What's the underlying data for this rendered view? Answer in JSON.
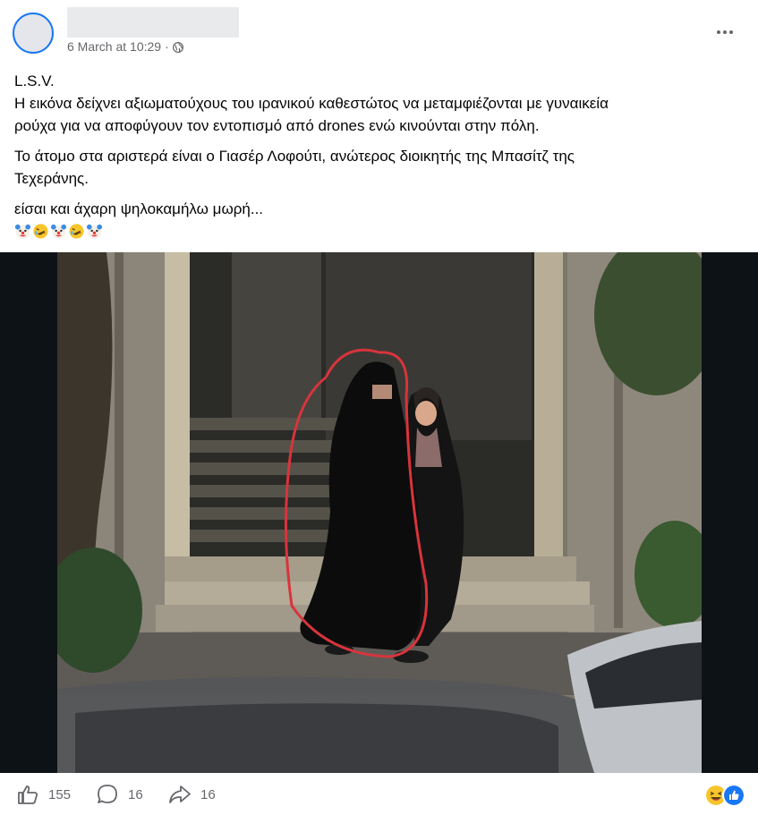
{
  "post": {
    "timestamp": "6 March at 10:29",
    "separator": "·",
    "privacy_icon": "globe-icon",
    "more_icon": "more-horizontal-icon",
    "text": {
      "line1": "L.S.V.",
      "line2": "Η εικόνα δείχνει αξιωματούχους του ιρανικού καθεστώτος να μεταμφιέζονται με γυναικεία",
      "line3": "ρούχα για να αποφύγουν τον εντοπισμό από drones ενώ κινούνται στην πόλη.",
      "para2_line1": "Το άτομο στα αριστερά είναι ο Γιασέρ Λοφούτι, ανώτερος διοικητής της Μπασίτζ της",
      "para2_line2": "Τεχεράνης.",
      "para3": "είσαι και άχαρη ψηλοκαμήλω μωρή..."
    },
    "emojis": [
      "clown-face",
      "rolling-laughing",
      "clown-face",
      "rolling-laughing",
      "clown-face"
    ],
    "image": {
      "subject": "two figures in black chador in front of building entrance, left figure circled in red",
      "circle_color": "#d8343c"
    }
  },
  "footer": {
    "like_count": "155",
    "comment_count": "16",
    "share_count": "16",
    "like_icon": "thumbs-up-icon",
    "comment_icon": "comment-icon",
    "share_icon": "share-icon",
    "reactions": [
      "haha-reaction",
      "like-reaction"
    ]
  },
  "colors": {
    "accent": "#1877f2",
    "secondary_text": "#65676b",
    "background": "#ffffff"
  }
}
